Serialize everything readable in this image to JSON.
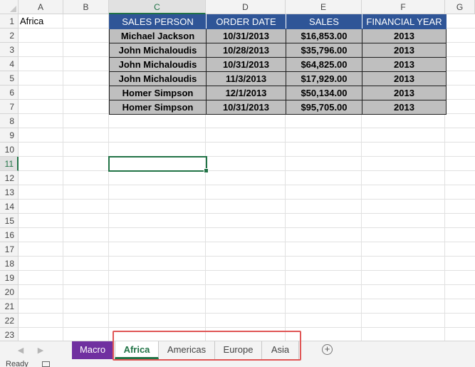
{
  "columns": [
    "A",
    "B",
    "C",
    "D",
    "E",
    "F",
    "G"
  ],
  "rows": [
    "1",
    "2",
    "3",
    "4",
    "5",
    "6",
    "7",
    "8",
    "9",
    "10",
    "11",
    "12",
    "13",
    "14",
    "15",
    "16",
    "17",
    "18",
    "19",
    "20",
    "21",
    "22",
    "23"
  ],
  "cells": {
    "a1": "Africa"
  },
  "table": {
    "headers": [
      "SALES PERSON",
      "ORDER DATE",
      "SALES",
      "FINANCIAL YEAR"
    ],
    "rows": [
      [
        "Michael Jackson",
        "10/31/2013",
        "$16,853.00",
        "2013"
      ],
      [
        "John Michaloudis",
        "10/28/2013",
        "$35,796.00",
        "2013"
      ],
      [
        "John Michaloudis",
        "10/31/2013",
        "$64,825.00",
        "2013"
      ],
      [
        "John Michaloudis",
        "11/3/2013",
        "$17,929.00",
        "2013"
      ],
      [
        "Homer Simpson",
        "12/1/2013",
        "$50,134.00",
        "2013"
      ],
      [
        "Homer Simpson",
        "10/31/2013",
        "$95,705.00",
        "2013"
      ]
    ]
  },
  "active_cell": {
    "column": "C",
    "row": "11"
  },
  "sheet_tabs": [
    {
      "label": "Macro",
      "state": "colored",
      "color": "#7030a0"
    },
    {
      "label": "Africa",
      "state": "active"
    },
    {
      "label": "Americas",
      "state": "normal"
    },
    {
      "label": "Europe",
      "state": "normal"
    },
    {
      "label": "Asia",
      "state": "normal"
    }
  ],
  "nav_icons": [
    "scroll-left-icon",
    "scroll-right-icon"
  ],
  "add_sheet_icon": "plus-circle-icon",
  "status": {
    "text": "Ready",
    "macro_icon": "macro-recording-icon"
  },
  "colors": {
    "accent": "#217346",
    "header_fill": "#2f5597",
    "data_fill": "#bfbfbf",
    "highlight_box": "#e05656"
  }
}
